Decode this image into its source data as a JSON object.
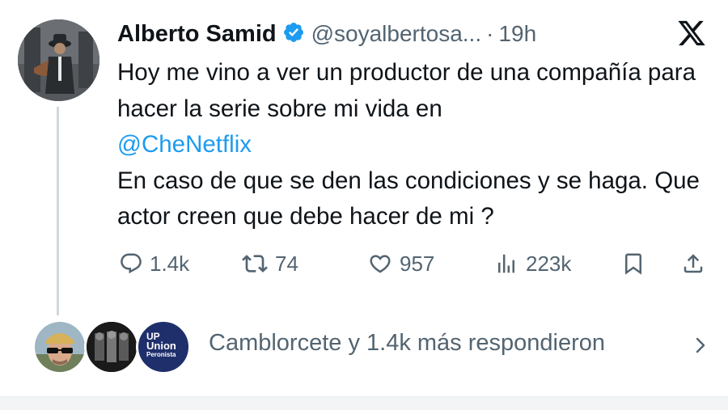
{
  "tweet": {
    "author_name": "Alberto Samid",
    "handle": "@soyalbertosa...",
    "separator": "·",
    "time": "19h",
    "text_line1": "Hoy me vino a ver un productor de una compañía para hacer la serie sobre mi vida en",
    "mention": "@CheNetflix",
    "text_line2": "En caso de que se den las condiciones y se haga. Que actor creen que debe hacer de mi ?"
  },
  "actions": {
    "replies": "1.4k",
    "reposts": "74",
    "likes": "957",
    "views": "223k"
  },
  "replies_summary": {
    "text": "Camblorcete y 1.4k más respondieron",
    "third_avatar_lines": [
      "UP",
      "Union",
      "Peronista"
    ]
  },
  "icons": {
    "verified": "verified-badge-icon",
    "x_logo": "x-logo-icon",
    "reply": "reply-icon",
    "repost": "repost-icon",
    "like": "heart-icon",
    "views": "views-icon",
    "bookmark": "bookmark-icon",
    "share": "share-icon",
    "chevron": "chevron-right-icon"
  },
  "colors": {
    "text": "#0f1419",
    "secondary": "#536471",
    "accent": "#1d9bf0",
    "thread_line": "#cfd9de",
    "union_navy": "#1f2f6b"
  }
}
